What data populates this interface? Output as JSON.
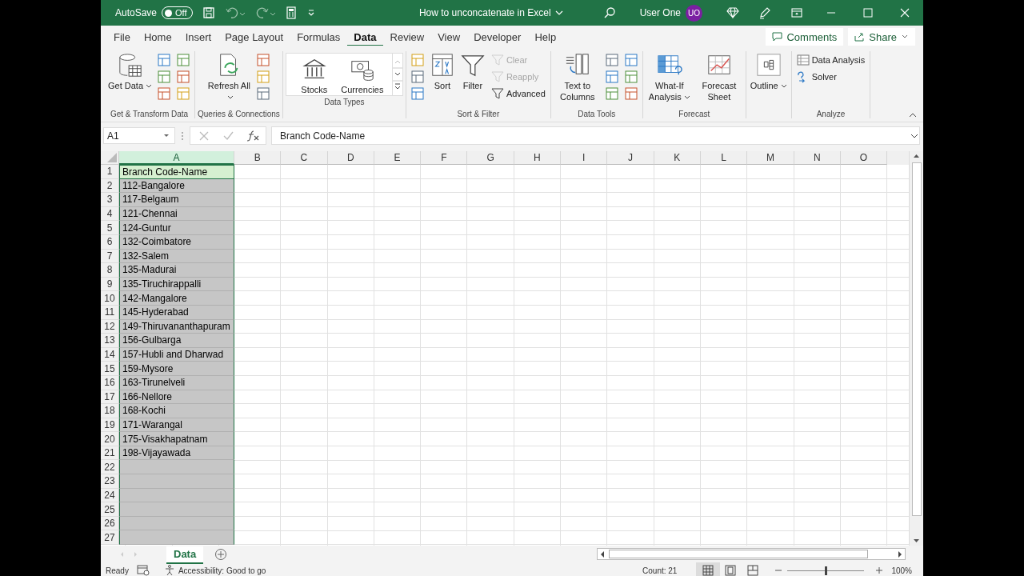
{
  "title_bar": {
    "autosave_label": "AutoSave",
    "autosave": {
      "label": "Off",
      "on": false
    },
    "document_title": "How to unconcatenate in Excel",
    "user_name": "User One",
    "user_initials": "UO"
  },
  "menu_tabs": [
    {
      "label": "File",
      "selected": false
    },
    {
      "label": "Home",
      "selected": false
    },
    {
      "label": "Insert",
      "selected": false
    },
    {
      "label": "Page Layout",
      "selected": false
    },
    {
      "label": "Formulas",
      "selected": false
    },
    {
      "label": "Data",
      "selected": true
    },
    {
      "label": "Review",
      "selected": false
    },
    {
      "label": "View",
      "selected": false
    },
    {
      "label": "Developer",
      "selected": false
    },
    {
      "label": "Help",
      "selected": false
    }
  ],
  "comments_button": "Comments",
  "share_button": "Share",
  "ribbon_groups": [
    {
      "label": "Get & Transform Data",
      "kind": "buttons",
      "items": [
        {
          "kind": "large",
          "label": "Get Data",
          "dropdown": true
        },
        {
          "kind": "icons"
        },
        {
          "kind": "icons"
        }
      ]
    },
    {
      "label": "Queries & Connections",
      "kind": "buttons",
      "items": [
        {
          "kind": "large",
          "label": "Refresh All",
          "dropdown": true
        },
        {
          "kind": "icons"
        }
      ]
    },
    {
      "label": "Data Types",
      "kind": "gallery",
      "items": [
        {
          "kind": "large",
          "label": "Stocks",
          "dropdown": false
        },
        {
          "kind": "large",
          "label": "Currencies",
          "dropdown": false
        }
      ]
    },
    {
      "label": "Sort & Filter",
      "kind": "buttons",
      "items": [
        {
          "kind": "icons"
        },
        {
          "kind": "large",
          "label": "Sort",
          "dropdown": false
        },
        {
          "kind": "large",
          "label": "Filter",
          "dropdown": false
        },
        {
          "kind": "small",
          "label": "Clear",
          "disabled": true
        },
        {
          "kind": "small",
          "label": "Reapply",
          "disabled": true
        },
        {
          "kind": "small",
          "label": "Advanced",
          "disabled": false
        }
      ]
    },
    {
      "label": "Data Tools",
      "kind": "buttons",
      "items": [
        {
          "kind": "large",
          "label": "Text to Columns",
          "dropdown": false
        },
        {
          "kind": "icons"
        },
        {
          "kind": "icons"
        }
      ]
    },
    {
      "label": "Forecast",
      "kind": "buttons",
      "items": [
        {
          "kind": "large",
          "label": "What-If Analysis",
          "dropdown": true
        },
        {
          "kind": "large",
          "label": "Forecast Sheet",
          "dropdown": false
        }
      ]
    },
    {
      "kind": "buttons",
      "items": [
        {
          "kind": "large",
          "label": "Outline",
          "dropdown": true
        }
      ]
    },
    {
      "label": "Analyze",
      "kind": "buttons",
      "items": [
        {
          "kind": "small",
          "label": "Data Analysis",
          "disabled": false
        },
        {
          "kind": "small",
          "label": "Solver",
          "disabled": false
        }
      ]
    }
  ],
  "formula_bar": {
    "name_box": "A1",
    "formula": "Branch Code-Name"
  },
  "columns": [
    {
      "label": "A",
      "selected": true
    },
    {
      "label": "B",
      "selected": false
    },
    {
      "label": "C",
      "selected": false
    },
    {
      "label": "D",
      "selected": false
    },
    {
      "label": "E",
      "selected": false
    },
    {
      "label": "F",
      "selected": false
    },
    {
      "label": "G",
      "selected": false
    },
    {
      "label": "H",
      "selected": false
    },
    {
      "label": "I",
      "selected": false
    },
    {
      "label": "J",
      "selected": false
    },
    {
      "label": "K",
      "selected": false
    },
    {
      "label": "L",
      "selected": false
    },
    {
      "label": "M",
      "selected": false
    },
    {
      "label": "N",
      "selected": false
    },
    {
      "label": "O",
      "selected": false
    }
  ],
  "rows": [
    {
      "number": "1",
      "a": "Branch Code-Name",
      "active": true
    },
    {
      "number": "2",
      "a": "112-Bangalore",
      "active": false
    },
    {
      "number": "3",
      "a": "117-Belgaum",
      "active": false
    },
    {
      "number": "4",
      "a": "121-Chennai",
      "active": false
    },
    {
      "number": "5",
      "a": "124-Guntur",
      "active": false
    },
    {
      "number": "6",
      "a": "132-Coimbatore",
      "active": false
    },
    {
      "number": "7",
      "a": "132-Salem",
      "active": false
    },
    {
      "number": "8",
      "a": "135-Madurai",
      "active": false
    },
    {
      "number": "9",
      "a": "135-Tiruchirappalli",
      "active": false
    },
    {
      "number": "10",
      "a": "142-Mangalore",
      "active": false
    },
    {
      "number": "11",
      "a": "145-Hyderabad",
      "active": false
    },
    {
      "number": "12",
      "a": "149-Thiruvananthapuram",
      "active": false
    },
    {
      "number": "13",
      "a": "156-Gulbarga",
      "active": false
    },
    {
      "number": "14",
      "a": "157-Hubli and Dharwad",
      "active": false
    },
    {
      "number": "15",
      "a": "159-Mysore",
      "active": false
    },
    {
      "number": "16",
      "a": "163-Tirunelveli",
      "active": false
    },
    {
      "number": "17",
      "a": "166-Nellore",
      "active": false
    },
    {
      "number": "18",
      "a": "168-Kochi",
      "active": false
    },
    {
      "number": "19",
      "a": "171-Warangal",
      "active": false
    },
    {
      "number": "20",
      "a": "175-Visakhapatnam",
      "active": false
    },
    {
      "number": "21",
      "a": "198-Vijayawada",
      "active": false
    },
    {
      "number": "22",
      "active": false
    },
    {
      "number": "23",
      "active": false
    },
    {
      "number": "24",
      "active": false
    },
    {
      "number": "25",
      "active": false
    },
    {
      "number": "26",
      "active": false
    },
    {
      "number": "27",
      "active": false
    }
  ],
  "sheet_tabs": [
    {
      "label": "Data",
      "selected": true
    }
  ],
  "status_bar": {
    "mode": "Ready",
    "accessibility": "Accessibility: Good to go",
    "count": "Count: 21",
    "zoom": {
      "label": "100%",
      "level": 0.5
    },
    "views": [
      {
        "selected": true
      },
      {
        "selected": false
      },
      {
        "selected": false
      }
    ]
  }
}
